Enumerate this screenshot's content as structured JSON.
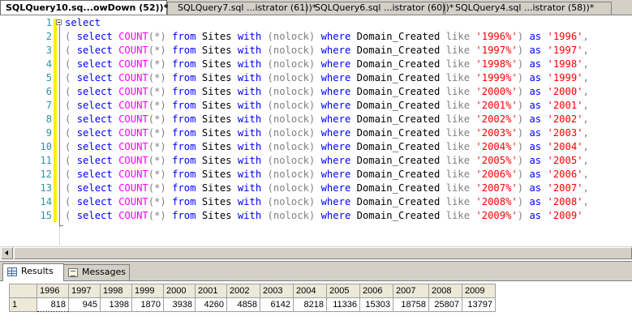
{
  "document_tabs": [
    {
      "label": "SQLQuery10.sq...owDown (52))*",
      "active": true
    },
    {
      "label": "SQLQuery7.sql ...istrator (61))*",
      "active": false
    },
    {
      "label": "SQLQuery6.sql ...istrator (60))*",
      "active": false
    },
    {
      "label": "SQLQuery4.sql ...istrator (58))*",
      "active": false
    }
  ],
  "editor": {
    "first_line": {
      "number": "1",
      "keyword": "select"
    },
    "lines": [
      {
        "number": "2",
        "year": "1996",
        "comma": ","
      },
      {
        "number": "3",
        "year": "1997",
        "comma": ","
      },
      {
        "number": "4",
        "year": "1998",
        "comma": ","
      },
      {
        "number": "5",
        "year": "1999",
        "comma": ","
      },
      {
        "number": "6",
        "year": "2000",
        "comma": ","
      },
      {
        "number": "7",
        "year": "2001",
        "comma": ","
      },
      {
        "number": "8",
        "year": "2002",
        "comma": ","
      },
      {
        "number": "9",
        "year": "2003",
        "comma": ","
      },
      {
        "number": "10",
        "year": "2004",
        "comma": ","
      },
      {
        "number": "11",
        "year": "2005",
        "comma": ","
      },
      {
        "number": "12",
        "year": "2006",
        "comma": ","
      },
      {
        "number": "13",
        "year": "2007",
        "comma": ","
      },
      {
        "number": "14",
        "year": "2008",
        "comma": ","
      },
      {
        "number": "15",
        "year": "2009",
        "comma": ""
      }
    ],
    "tokens": {
      "open": "(",
      "select": "select",
      "count": "COUNT",
      "star": "(*)",
      "from": "from",
      "table": "Sites",
      "with": "with",
      "nolock": "(nolock)",
      "where": "where",
      "column": "Domain_Created",
      "like": "like",
      "as": "as",
      "close": ")"
    }
  },
  "result_tabs": [
    {
      "label": "Results",
      "icon": "grid-icon",
      "active": true
    },
    {
      "label": "Messages",
      "icon": "messages-icon",
      "active": false
    }
  ],
  "results_grid": {
    "columns": [
      "1996",
      "1997",
      "1998",
      "1999",
      "2000",
      "2001",
      "2002",
      "2003",
      "2004",
      "2005",
      "2006",
      "2007",
      "2008",
      "2009"
    ],
    "rows": [
      {
        "row_number": "1",
        "values": [
          "818",
          "945",
          "1398",
          "1870",
          "3938",
          "4260",
          "4858",
          "6142",
          "8218",
          "11336",
          "15303",
          "18758",
          "25807",
          "13797"
        ]
      }
    ]
  }
}
